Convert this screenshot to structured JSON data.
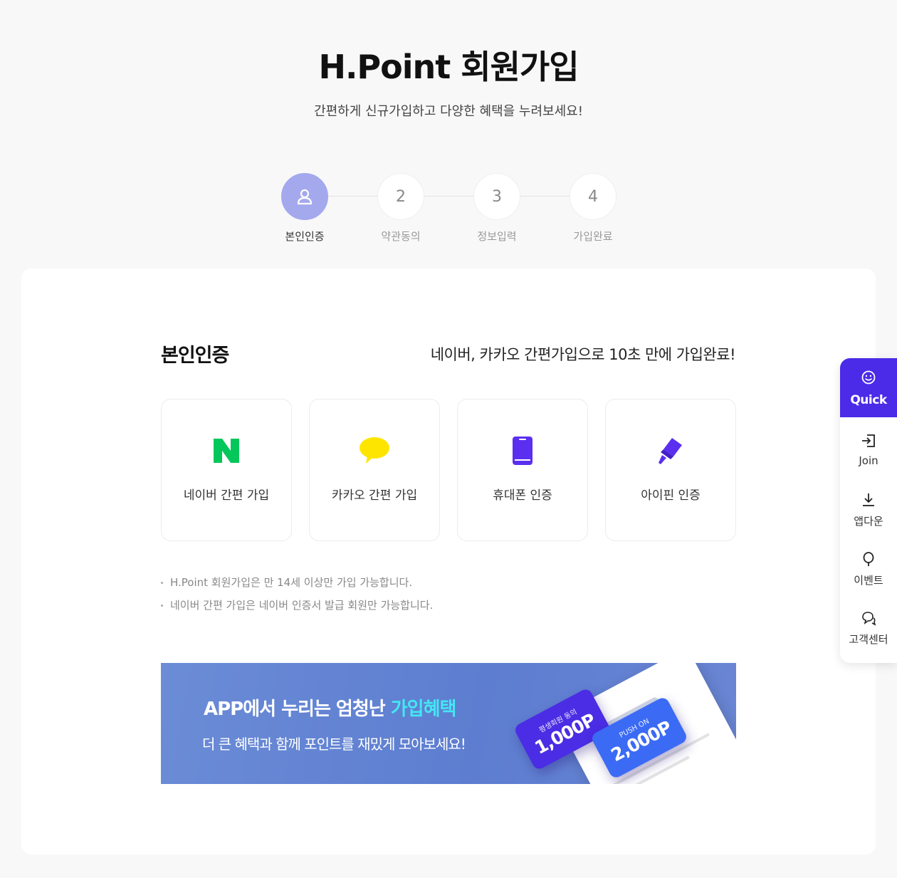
{
  "header": {
    "title": "H.Point 회원가입",
    "subtitle": "간편하게 신규가입하고 다양한 혜택을 누려보세요!"
  },
  "steps": [
    {
      "number": "",
      "label": "본인인증",
      "active": true,
      "icon": "person-icon"
    },
    {
      "number": "2",
      "label": "약관동의",
      "active": false
    },
    {
      "number": "3",
      "label": "정보입력",
      "active": false
    },
    {
      "number": "4",
      "label": "가입완료",
      "active": false
    }
  ],
  "section": {
    "title": "본인인증",
    "promo": "네이버, 카카오 간편가입으로 10초 만에 가입완료!"
  },
  "options": [
    {
      "label": "네이버 간편 가입",
      "icon": "naver-icon",
      "color": "#03c75a"
    },
    {
      "label": "카카오 간편 가입",
      "icon": "kakao-icon",
      "color": "#fee500"
    },
    {
      "label": "휴대폰 인증",
      "icon": "phone-icon",
      "color": "#5b2ff0"
    },
    {
      "label": "아이핀 인증",
      "icon": "ipin-icon",
      "color": "#5b2ff0"
    }
  ],
  "notes": [
    "H.Point 회원가입은 만 14세 이상만 가입 가능합니다.",
    "네이버 간편 가입은 네이버 인증서 발급 회원만 가능합니다."
  ],
  "banner": {
    "head_prefix": "APP에서 누리는 엄청난 ",
    "head_highlight": "가입혜택",
    "sub": "더 큰 혜택과 함께 포인트를 재밌게 모아보세요!",
    "coupon1_tag": "평생회원 동의",
    "coupon1_value": "1,000P",
    "coupon2_tag": "PUSH ON",
    "coupon2_value": "2,000P"
  },
  "quick": {
    "title": "Quick",
    "items": [
      {
        "label": "Join",
        "icon": "login-icon"
      },
      {
        "label": "앱다운",
        "icon": "download-icon"
      },
      {
        "label": "이벤트",
        "icon": "balloon-icon"
      },
      {
        "label": "고객센터",
        "icon": "chat-icon"
      }
    ]
  },
  "colors": {
    "accent": "#4b2be8",
    "step_active": "#a4a9ee",
    "banner_highlight": "#44e6f2"
  }
}
